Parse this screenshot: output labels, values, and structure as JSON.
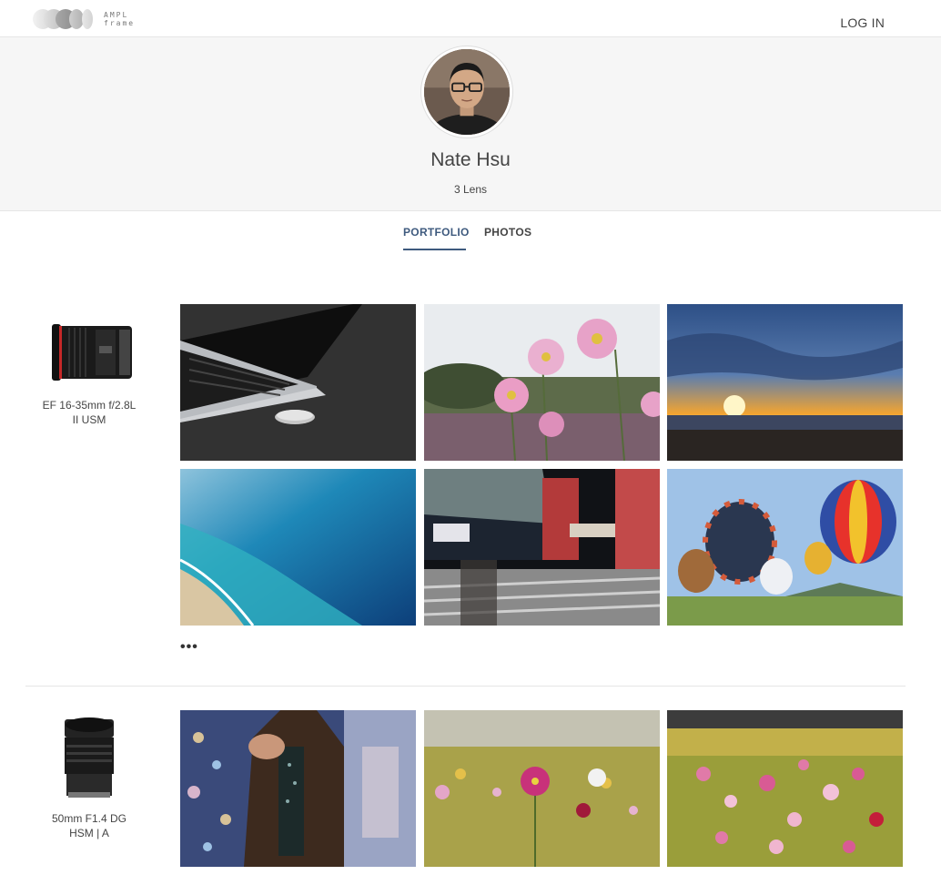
{
  "header": {
    "logo_text_line1": "AMPL",
    "logo_text_line2": "frame",
    "login_label": "LOG IN"
  },
  "profile": {
    "name": "Nate Hsu",
    "lens_count": "3 Lens"
  },
  "tabs": [
    {
      "label": "PORTFOLIO",
      "active": true
    },
    {
      "label": "PHOTOS",
      "active": false
    }
  ],
  "lenses": [
    {
      "name_line1": "EF 16-35mm f/2.8L",
      "name_line2": "II USM",
      "more_label": "•••",
      "photos": [
        "laptop-and-coin",
        "pink-cosmos-flowers",
        "sunset-over-sea",
        "turquoise-ocean-aerial",
        "night-street-scene",
        "hot-air-balloons"
      ]
    },
    {
      "name_line1": "50mm F1.4 DG",
      "name_line2": "HSM | A",
      "photos": [
        "woman-in-coat-with-lights",
        "cosmos-field-yellow",
        "cosmos-field-pink"
      ]
    }
  ],
  "colors": {
    "accent": "#3e5a7e",
    "profile_bg": "#f6f6f6",
    "text": "#444444"
  }
}
